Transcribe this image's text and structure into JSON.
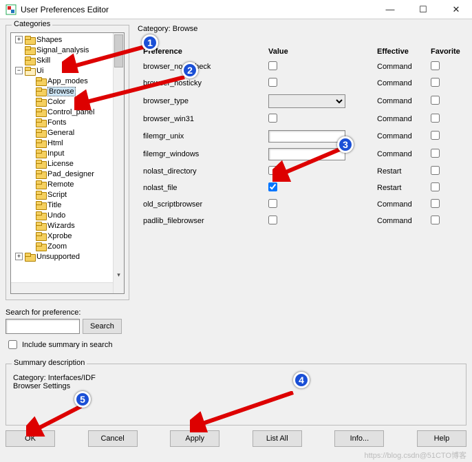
{
  "window": {
    "title": "User Preferences Editor",
    "min": "—",
    "max": "☐",
    "close": "✕"
  },
  "categories": {
    "legend": "Categories",
    "items": [
      {
        "level": 0,
        "exp": "+",
        "label": "Shapes",
        "open": false
      },
      {
        "level": 0,
        "exp": "",
        "label": "Signal_analysis",
        "open": false
      },
      {
        "level": 0,
        "exp": "",
        "label": "Skill",
        "open": false
      },
      {
        "level": 0,
        "exp": "-",
        "label": "Ui",
        "open": true
      },
      {
        "level": 1,
        "exp": "",
        "label": "App_modes",
        "open": false
      },
      {
        "level": 1,
        "exp": "",
        "label": "Browse",
        "open": false,
        "selected": true
      },
      {
        "level": 1,
        "exp": "",
        "label": "Color",
        "open": false
      },
      {
        "level": 1,
        "exp": "",
        "label": "Control_panel",
        "open": false
      },
      {
        "level": 1,
        "exp": "",
        "label": "Fonts",
        "open": false
      },
      {
        "level": 1,
        "exp": "",
        "label": "General",
        "open": false
      },
      {
        "level": 1,
        "exp": "",
        "label": "Html",
        "open": false
      },
      {
        "level": 1,
        "exp": "",
        "label": "Input",
        "open": false
      },
      {
        "level": 1,
        "exp": "",
        "label": "License",
        "open": false
      },
      {
        "level": 1,
        "exp": "",
        "label": "Pad_designer",
        "open": false
      },
      {
        "level": 1,
        "exp": "",
        "label": "Remote",
        "open": false
      },
      {
        "level": 1,
        "exp": "",
        "label": "Script",
        "open": false
      },
      {
        "level": 1,
        "exp": "",
        "label": "Title",
        "open": false
      },
      {
        "level": 1,
        "exp": "",
        "label": "Undo",
        "open": false
      },
      {
        "level": 1,
        "exp": "",
        "label": "Wizards",
        "open": false
      },
      {
        "level": 1,
        "exp": "",
        "label": "Xprobe",
        "open": false
      },
      {
        "level": 1,
        "exp": "",
        "label": "Zoom",
        "open": false
      },
      {
        "level": 0,
        "exp": "+",
        "label": "Unsupported",
        "open": false
      }
    ]
  },
  "category_label": "Category:  Browse",
  "prefs": {
    "headers": {
      "pref": "Preference",
      "value": "Value",
      "eff": "Effective",
      "fav": "Favorite"
    },
    "rows": [
      {
        "name": "browser_nodircheck",
        "type": "check",
        "checked": false,
        "eff": "Command"
      },
      {
        "name": "browser_nosticky",
        "type": "check",
        "checked": false,
        "eff": "Command"
      },
      {
        "name": "browser_type",
        "type": "select",
        "value": "",
        "eff": "Command"
      },
      {
        "name": "browser_win31",
        "type": "check",
        "checked": false,
        "eff": "Command"
      },
      {
        "name": "filemgr_unix",
        "type": "text",
        "value": "",
        "eff": "Command"
      },
      {
        "name": "filemgr_windows",
        "type": "text",
        "value": "",
        "eff": "Command"
      },
      {
        "name": "nolast_directory",
        "type": "check",
        "checked": false,
        "eff": "Restart"
      },
      {
        "name": "nolast_file",
        "type": "check",
        "checked": true,
        "eff": "Restart"
      },
      {
        "name": "old_scriptbrowser",
        "type": "check",
        "checked": false,
        "eff": "Command"
      },
      {
        "name": "padlib_filebrowser",
        "type": "check",
        "checked": false,
        "eff": "Command"
      }
    ]
  },
  "search": {
    "label": "Search for preference:",
    "button": "Search",
    "include": "Include summary in search",
    "value": ""
  },
  "summary": {
    "legend": "Summary description",
    "line1": "Category: Interfaces/IDF",
    "line2": "Browser Settings"
  },
  "buttons": {
    "ok": "OK",
    "cancel": "Cancel",
    "apply": "Apply",
    "listall": "List All",
    "info": "Info...",
    "help": "Help"
  },
  "watermark": "https://blog.csdn@51CTO博客"
}
